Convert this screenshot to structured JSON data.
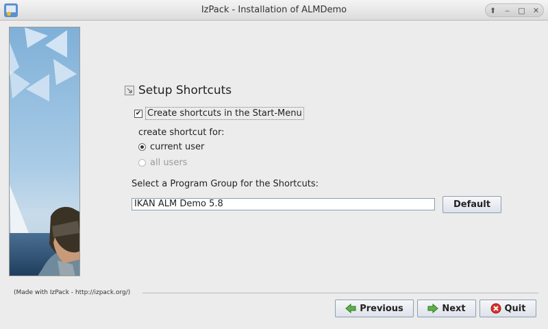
{
  "window": {
    "title": "IzPack - Installation of ALMDemo"
  },
  "panel": {
    "heading": "Setup Shortcuts",
    "create_shortcuts_label": "Create shortcuts in the Start-Menu",
    "create_shortcuts_checked": true,
    "create_for_label": "create shortcut for:",
    "radio_current_user": "current user",
    "radio_all_users": "all users",
    "program_group_label": "Select a Program Group for the Shortcuts:",
    "program_group_value": "IKAN ALM Demo 5.8",
    "default_button": "Default"
  },
  "footer": {
    "made_with": "(Made with IzPack - http://izpack.org/)",
    "previous": "Previous",
    "next": "Next",
    "quit": "Quit"
  },
  "icons": [
    "app-icon",
    "restore-icon",
    "minimize-icon",
    "maximize-icon",
    "close-icon",
    "previous-arrow-icon",
    "next-arrow-icon",
    "quit-icon",
    "shortcut-heading-icon"
  ]
}
